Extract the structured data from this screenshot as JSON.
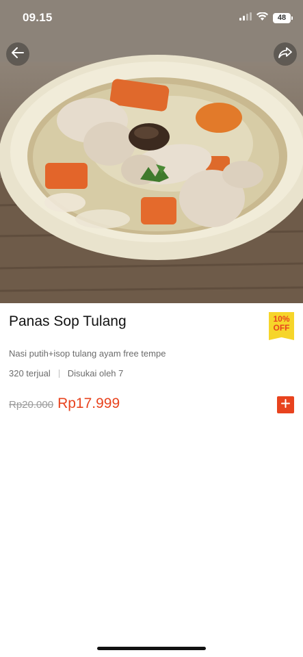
{
  "status_bar": {
    "time": "09.15",
    "battery": "48"
  },
  "product": {
    "name": "Panas Sop Tulang",
    "description": "Nasi putih+isop tulang ayam free tempe",
    "sold": "320 terjual",
    "likes": "Disukai oleh 7",
    "original_price": "Rp20.000",
    "price": "Rp17.999",
    "discount_line1": "10%",
    "discount_line2": "OFF"
  },
  "icons": {
    "back": "arrow-left-icon",
    "share": "share-forward-icon",
    "add": "plus-icon"
  },
  "colors": {
    "accent": "#e8431e",
    "badge": "#f6d52a"
  }
}
